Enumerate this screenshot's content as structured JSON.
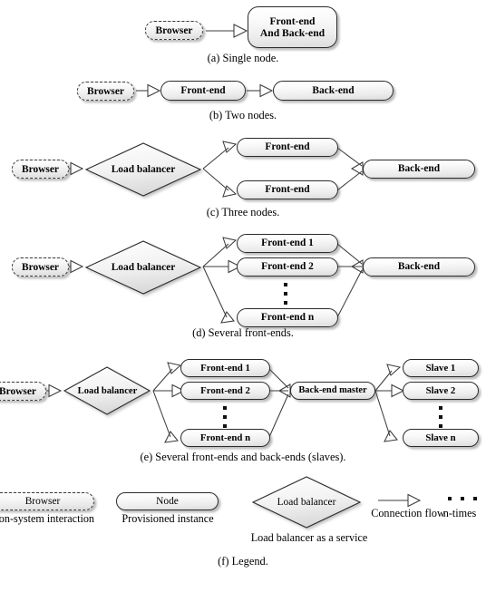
{
  "figure": {
    "panels": [
      {
        "id": "a",
        "caption": "(a)  Single node.",
        "nodes": {
          "browser": "Browser",
          "combined": "Front-end\nAnd Back-end"
        }
      },
      {
        "id": "b",
        "caption": "(b)  Two nodes.",
        "nodes": {
          "browser": "Browser",
          "frontend": "Front-end",
          "backend": "Back-end"
        }
      },
      {
        "id": "c",
        "caption": "(c)  Three nodes.",
        "nodes": {
          "browser": "Browser",
          "load_balancer": "Load balancer",
          "frontend_1": "Front-end",
          "frontend_2": "Front-end",
          "backend": "Back-end"
        }
      },
      {
        "id": "d",
        "caption": "(d)  Several front-ends.",
        "nodes": {
          "browser": "Browser",
          "load_balancer": "Load balancer",
          "frontend_1": "Front-end 1",
          "frontend_2": "Front-end 2",
          "frontend_n": "Front-end n",
          "backend": "Back-end"
        }
      },
      {
        "id": "e",
        "caption": "(e)  Several front-ends and back-ends (slaves).",
        "nodes": {
          "browser": "Browser",
          "load_balancer": "Load balancer",
          "frontend_1": "Front-end 1",
          "frontend_2": "Front-end 2",
          "frontend_n": "Front-end n",
          "backend_master": "Back-end master",
          "slave_1": "Slave 1",
          "slave_2": "Slave 2",
          "slave_n": "Slave n"
        }
      },
      {
        "id": "f",
        "caption": "(f)  Legend.",
        "legend": {
          "browser_shape": "Browser",
          "browser_desc": "Non-system interaction",
          "node_shape": "Node",
          "node_desc": "Provisioned instance",
          "balancer_shape": "Load balancer",
          "balancer_desc": "Load balancer as a service",
          "flow_desc": "Connection flow",
          "ntimes_desc": "n-times"
        }
      }
    ]
  },
  "colors": {
    "stroke": "#3c3c3c",
    "node_border": "#2b2b2b",
    "fill_light": "#ffffff",
    "fill_dark": "#dcdcdc",
    "shadow": "rgba(90,90,90,0.40)",
    "text": "#000000"
  }
}
